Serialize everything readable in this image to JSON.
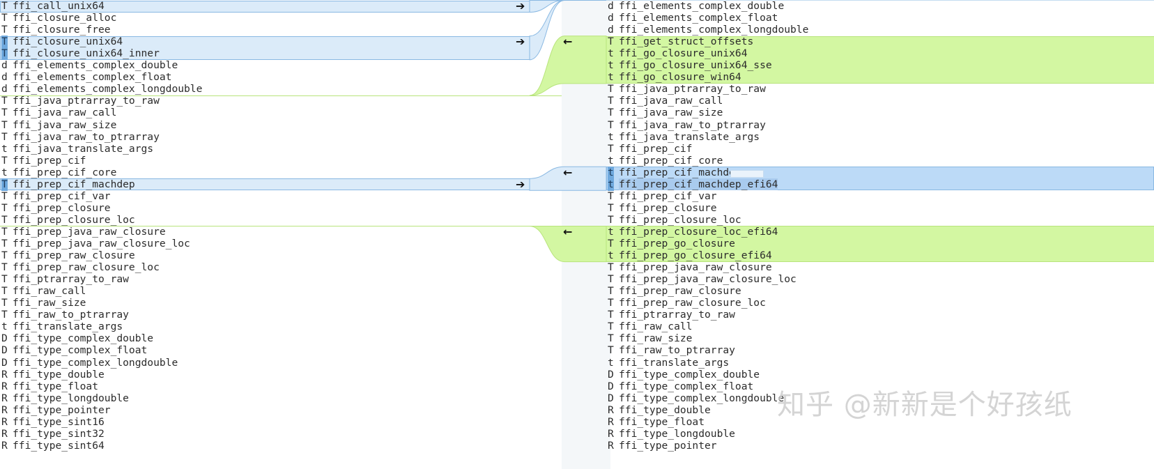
{
  "left_rows": [
    {
      "kind": "T",
      "name": "ffi_call_unix64"
    },
    {
      "kind": "T",
      "name": "ffi_closure_alloc"
    },
    {
      "kind": "T",
      "name": "ffi_closure_free"
    },
    {
      "kind": "T",
      "name": "ffi_closure_unix64"
    },
    {
      "kind": "T",
      "name": "ffi_closure_unix64_inner"
    },
    {
      "kind": "d",
      "name": "ffi_elements_complex_double"
    },
    {
      "kind": "d",
      "name": "ffi_elements_complex_float"
    },
    {
      "kind": "d",
      "name": "ffi_elements_complex_longdouble"
    },
    {
      "kind": "T",
      "name": "ffi_java_ptrarray_to_raw"
    },
    {
      "kind": "T",
      "name": "ffi_java_raw_call"
    },
    {
      "kind": "T",
      "name": "ffi_java_raw_size"
    },
    {
      "kind": "T",
      "name": "ffi_java_raw_to_ptrarray"
    },
    {
      "kind": "t",
      "name": "ffi_java_translate_args"
    },
    {
      "kind": "T",
      "name": "ffi_prep_cif"
    },
    {
      "kind": "t",
      "name": "ffi_prep_cif_core"
    },
    {
      "kind": "T",
      "name": "ffi_prep_cif_machdep"
    },
    {
      "kind": "T",
      "name": "ffi_prep_cif_var"
    },
    {
      "kind": "T",
      "name": "ffi_prep_closure"
    },
    {
      "kind": "T",
      "name": "ffi_prep_closure_loc"
    },
    {
      "kind": "T",
      "name": "ffi_prep_java_raw_closure"
    },
    {
      "kind": "T",
      "name": "ffi_prep_java_raw_closure_loc"
    },
    {
      "kind": "T",
      "name": "ffi_prep_raw_closure"
    },
    {
      "kind": "T",
      "name": "ffi_prep_raw_closure_loc"
    },
    {
      "kind": "T",
      "name": "ffi_ptrarray_to_raw"
    },
    {
      "kind": "T",
      "name": "ffi_raw_call"
    },
    {
      "kind": "T",
      "name": "ffi_raw_size"
    },
    {
      "kind": "T",
      "name": "ffi_raw_to_ptrarray"
    },
    {
      "kind": "t",
      "name": "ffi_translate_args"
    },
    {
      "kind": "D",
      "name": "ffi_type_complex_double"
    },
    {
      "kind": "D",
      "name": "ffi_type_complex_float"
    },
    {
      "kind": "D",
      "name": "ffi_type_complex_longdouble"
    },
    {
      "kind": "R",
      "name": "ffi_type_double"
    },
    {
      "kind": "R",
      "name": "ffi_type_float"
    },
    {
      "kind": "R",
      "name": "ffi_type_longdouble"
    },
    {
      "kind": "R",
      "name": "ffi_type_pointer"
    },
    {
      "kind": "R",
      "name": "ffi_type_sint16"
    },
    {
      "kind": "R",
      "name": "ffi_type_sint32"
    },
    {
      "kind": "R",
      "name": "ffi_type_sint64"
    }
  ],
  "right_rows": [
    {
      "kind": "d",
      "name": "ffi_elements_complex_double"
    },
    {
      "kind": "d",
      "name": "ffi_elements_complex_float"
    },
    {
      "kind": "d",
      "name": "ffi_elements_complex_longdouble"
    },
    {
      "kind": "T",
      "name": "ffi_get_struct_offsets"
    },
    {
      "kind": "t",
      "name": "ffi_go_closure_unix64"
    },
    {
      "kind": "t",
      "name": "ffi_go_closure_unix64_sse"
    },
    {
      "kind": "t",
      "name": "ffi_go_closure_win64"
    },
    {
      "kind": "T",
      "name": "ffi_java_ptrarray_to_raw"
    },
    {
      "kind": "T",
      "name": "ffi_java_raw_call"
    },
    {
      "kind": "T",
      "name": "ffi_java_raw_size"
    },
    {
      "kind": "T",
      "name": "ffi_java_raw_to_ptrarray"
    },
    {
      "kind": "t",
      "name": "ffi_java_translate_args"
    },
    {
      "kind": "T",
      "name": "ffi_prep_cif"
    },
    {
      "kind": "t",
      "name": "ffi_prep_cif_core"
    },
    {
      "kind": "t",
      "name": "ffi_prep_cif_machdep"
    },
    {
      "kind": "t",
      "name": "ffi_prep_cif_machdep_efi64"
    },
    {
      "kind": "T",
      "name": "ffi_prep_cif_var"
    },
    {
      "kind": "T",
      "name": "ffi_prep_closure"
    },
    {
      "kind": "T",
      "name": "ffi_prep_closure_loc"
    },
    {
      "kind": "t",
      "name": "ffi_prep_closure_loc_efi64"
    },
    {
      "kind": "T",
      "name": "ffi_prep_go_closure"
    },
    {
      "kind": "t",
      "name": "ffi_prep_go_closure_efi64"
    },
    {
      "kind": "T",
      "name": "ffi_prep_java_raw_closure"
    },
    {
      "kind": "T",
      "name": "ffi_prep_java_raw_closure_loc"
    },
    {
      "kind": "T",
      "name": "ffi_prep_raw_closure"
    },
    {
      "kind": "T",
      "name": "ffi_prep_raw_closure_loc"
    },
    {
      "kind": "T",
      "name": "ffi_ptrarray_to_raw"
    },
    {
      "kind": "T",
      "name": "ffi_raw_call"
    },
    {
      "kind": "T",
      "name": "ffi_raw_size"
    },
    {
      "kind": "T",
      "name": "ffi_raw_to_ptrarray"
    },
    {
      "kind": "t",
      "name": "ffi_translate_args"
    },
    {
      "kind": "D",
      "name": "ffi_type_complex_double"
    },
    {
      "kind": "D",
      "name": "ffi_type_complex_float"
    },
    {
      "kind": "D",
      "name": "ffi_type_complex_longdouble"
    },
    {
      "kind": "R",
      "name": "ffi_type_double"
    },
    {
      "kind": "R",
      "name": "ffi_type_float"
    },
    {
      "kind": "R",
      "name": "ffi_type_longdouble"
    },
    {
      "kind": "R",
      "name": "ffi_type_pointer"
    }
  ],
  "chunks": [
    {
      "type": "changed",
      "left_rows": [
        0,
        0
      ],
      "right_rows": [
        0,
        -1
      ],
      "arrow_left": true
    },
    {
      "type": "changed",
      "left_rows": [
        3,
        4
      ],
      "right_rows": [
        0,
        -1
      ],
      "arrow_left": true
    },
    {
      "type": "inserted",
      "left_rows": [
        8,
        7
      ],
      "right_rows": [
        3,
        6
      ],
      "arrow_right": true
    },
    {
      "type": "changed",
      "left_rows": [
        15,
        15
      ],
      "right_rows": [
        14,
        15
      ],
      "arrow_left": true,
      "arrow_right": true
    },
    {
      "type": "inserted",
      "left_rows": [
        19,
        18
      ],
      "right_rows": [
        19,
        21
      ],
      "arrow_right": true
    }
  ],
  "colors": {
    "changed_fill": "#dbebf9",
    "changed_border": "#89b8e2",
    "inserted_fill": "#d3f7a2",
    "inserted_border": "#b8e47c"
  },
  "icons": {
    "push_right": "arrow-right-icon",
    "push_left": "arrow-left-icon"
  },
  "watermark": "知乎 @新新是个好孩纸"
}
